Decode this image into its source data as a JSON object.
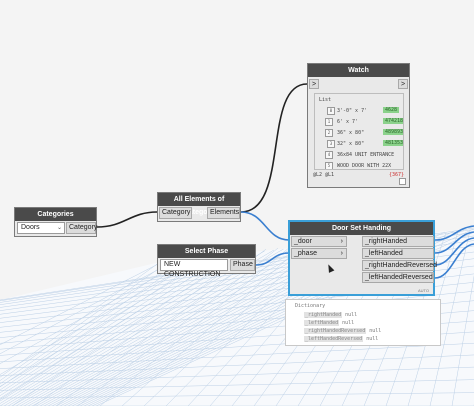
{
  "watch": {
    "title": "Watch",
    "in_port": ">",
    "out_port": ">",
    "list_label": "List",
    "rows": [
      {
        "index": "0",
        "text": "3'-0\" x 7'",
        "id": "4628"
      },
      {
        "index": "1",
        "text": "6' x 7'",
        "id": "474218"
      },
      {
        "index": "2",
        "text": "36\" x 80\"",
        "id": "489893"
      },
      {
        "index": "3",
        "text": "32\" x 80\"",
        "id": "481353"
      },
      {
        "index": "4",
        "text": "36x84 UNIT ENTRANCE",
        "id": ""
      },
      {
        "index": "5",
        "text": "WOOD DOOR WITH 22X",
        "id": ""
      }
    ],
    "footer_left": "@L2 @L1",
    "footer_count": "{367}"
  },
  "categories": {
    "title": "Categories",
    "selected": "Doors",
    "output": "Category"
  },
  "all_elements": {
    "title": "All Elements of Category",
    "input": "Category",
    "output": "Elements"
  },
  "select_phase": {
    "title": "Select Phase",
    "selected": "NEW CONSTRUCTION",
    "output": "Phase"
  },
  "door_set": {
    "title": "Door Set Handing",
    "inputs": [
      "_door",
      "_phase"
    ],
    "outputs": [
      "_rightHanded",
      "_leftHanded",
      "_rightHandedReversed",
      "_leftHandedReversed"
    ],
    "lacing": "AUTO"
  },
  "tooltip": {
    "header": "Dictionary",
    "rows": [
      {
        "key": "_rightHanded",
        "value": "null"
      },
      {
        "key": "_leftHanded",
        "value": "null"
      },
      {
        "key": "_rightHandedReversed",
        "value": "null"
      },
      {
        "key": "_leftHandedReversed",
        "value": "null"
      }
    ]
  },
  "colors": {
    "wire": "#3a7fd0",
    "wire_dark": "#222222",
    "selection": "#3a9fd8",
    "grid": "#bcd0e6"
  }
}
